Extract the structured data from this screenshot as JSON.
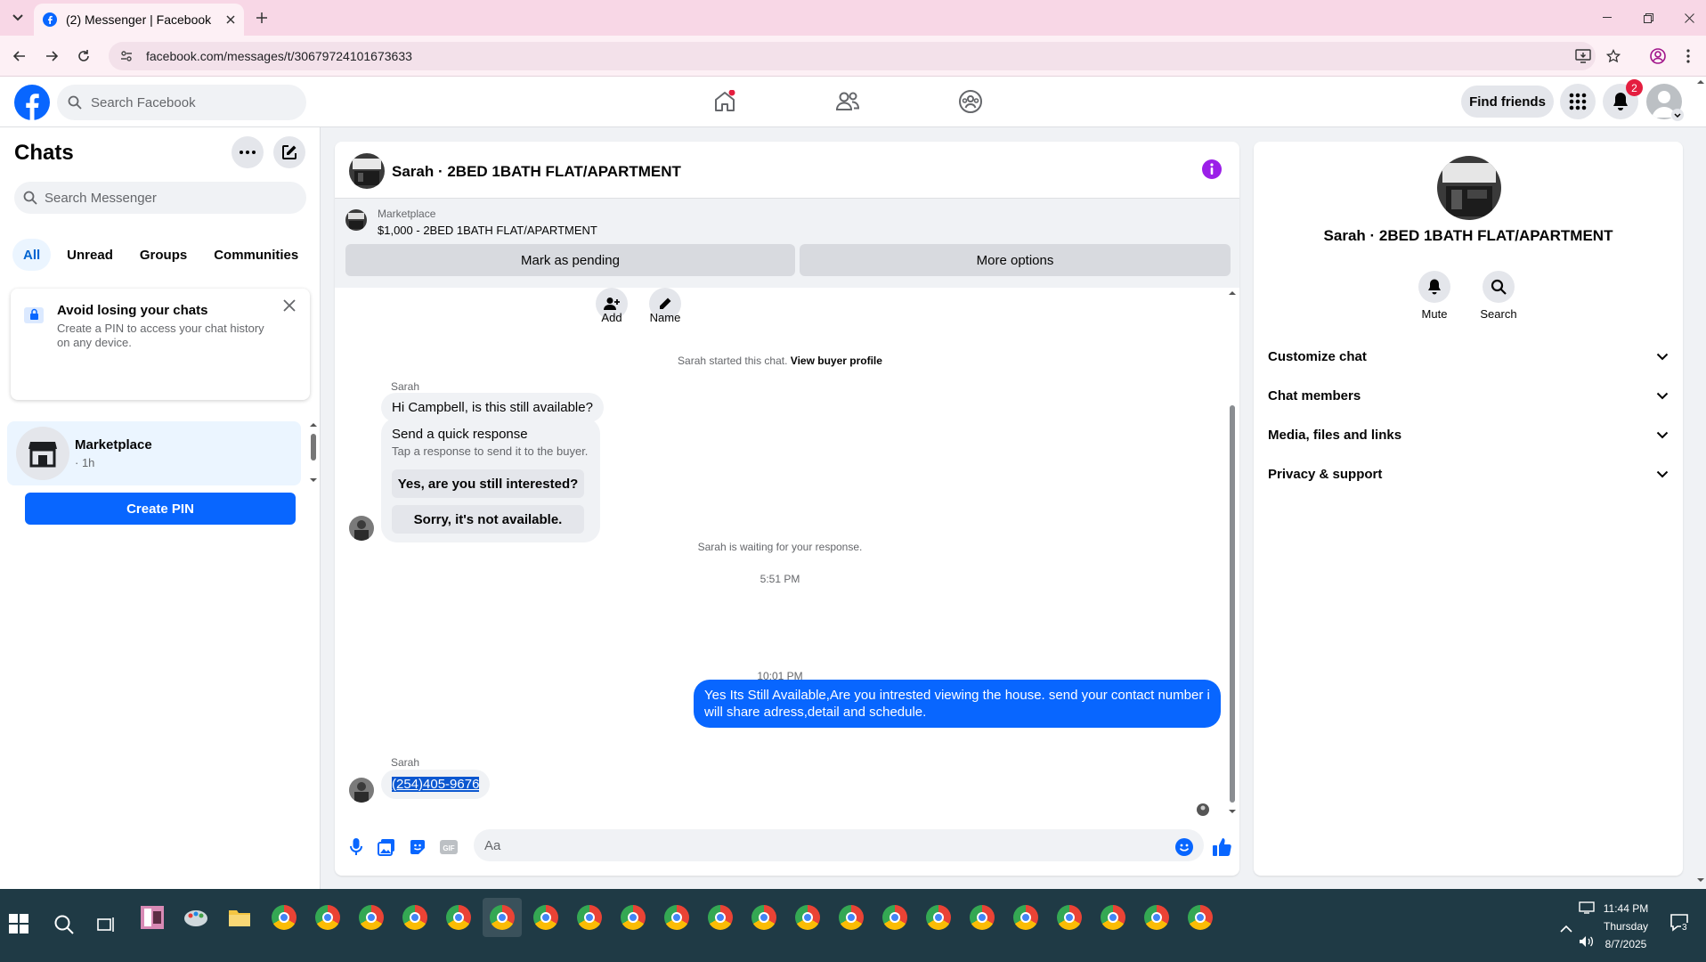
{
  "browser": {
    "tab_title": "(2) Messenger | Facebook",
    "url": "facebook.com/messages/t/30679724101673633"
  },
  "fbnav": {
    "search_placeholder": "Search Facebook",
    "find_friends": "Find friends",
    "notification_count": "2"
  },
  "left": {
    "title": "Chats",
    "search_placeholder": "Search Messenger",
    "filters": [
      "All",
      "Unread",
      "Groups",
      "Communities"
    ],
    "pin_title": "Avoid losing your chats",
    "pin_desc": "Create a PIN to access your chat history on any device.",
    "create_pin": "Create PIN",
    "conversation": {
      "name": "Marketplace",
      "time": "· 1h"
    }
  },
  "chat": {
    "title": "Sarah · 2BED 1BATH FLAT/APARTMENT",
    "marketplace_label": "Marketplace",
    "listing": "$1,000 - 2BED 1BATH FLAT/APARTMENT",
    "mark_pending": "Mark as pending",
    "more_options": "More options",
    "actions": {
      "add": "Add",
      "name": "Name"
    },
    "started_text": "Sarah started this chat.",
    "view_profile": "View buyer profile",
    "sender": "Sarah",
    "msg1": "Hi Campbell, is this still available?",
    "quick_title": "Send a quick response",
    "quick_desc": "Tap a response to send it to the buyer.",
    "quick_options": [
      "Yes, are you still interested?",
      "Sorry, it's not available."
    ],
    "waiting": "Sarah is waiting for your response.",
    "time1": "5:51 PM",
    "outgoing": "Yes Its Still Available,Are you intrested viewing the house. send your contact number i will share adress,detail and schedule.",
    "time2": "10:01 PM",
    "sender2": "Sarah",
    "phone": "(254)405-9676",
    "input_placeholder": "Aa"
  },
  "info": {
    "name": "Sarah · 2BED 1BATH FLAT/APARTMENT",
    "mute": "Mute",
    "search": "Search",
    "sections": [
      "Customize chat",
      "Chat members",
      "Media, files and links",
      "Privacy & support"
    ]
  },
  "taskbar": {
    "time": "11:44 PM",
    "day": "Thursday",
    "date": "8/7/2025",
    "notification_count": "3"
  },
  "colors": {
    "fb_blue": "#0866ff",
    "tab_bar": "#f8d7e6",
    "taskbar": "#1f3a45"
  }
}
